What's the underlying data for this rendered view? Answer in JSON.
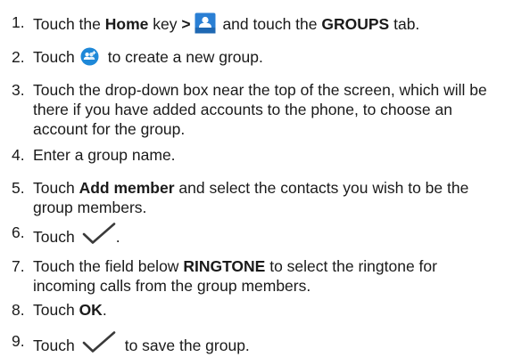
{
  "steps": [
    {
      "num": "1.",
      "t1": "Touch the ",
      "b1": "Home",
      "t2": " key ",
      "b2": ">",
      "t3": " and touch the ",
      "b3": "GROUPS",
      "t4": " tab."
    },
    {
      "num": "2.",
      "t1": "Touch",
      "t2": "to create a new group."
    },
    {
      "num": "3.",
      "t1": "Touch the drop-down box near the top of the screen, which will be there if you have added accounts to the phone, to choose an account for the group."
    },
    {
      "num": "4.",
      "t1": "Enter a group name."
    },
    {
      "num": "5.",
      "t1": "Touch ",
      "b1": "Add member",
      "t2": " and select the contacts you wish to be the group members."
    },
    {
      "num": "6.",
      "t1": "Touch",
      "t2": "."
    },
    {
      "num": "7.",
      "t1": "Touch the field below ",
      "b1": "RINGTONE",
      "t2": " to select the ringtone for incoming calls from the group members."
    },
    {
      "num": "8.",
      "t1": "Touch ",
      "b1": "OK",
      "t2": "."
    },
    {
      "num": "9.",
      "t1": "Touch",
      "t2": "to save the group."
    }
  ],
  "icons": {
    "contacts_app": "contacts-app-icon",
    "add_group": "add-group-icon",
    "checkmark": "checkmark-icon",
    "contacts_color": "#2a7fd4",
    "add_group_color": "#1e88d8"
  }
}
